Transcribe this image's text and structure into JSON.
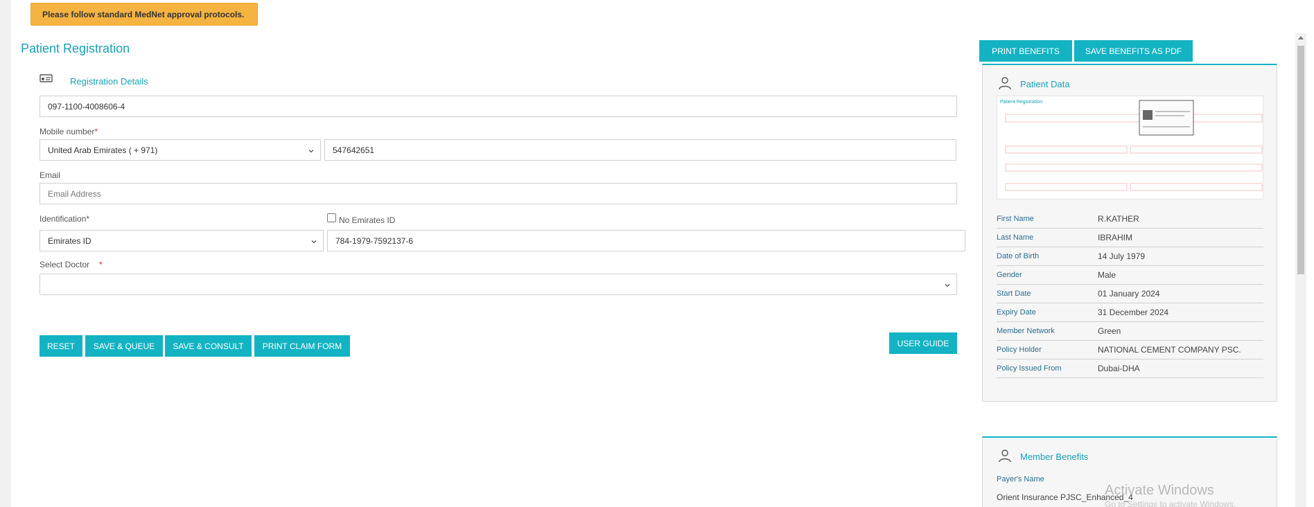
{
  "banner": {
    "text": "Please follow standard MedNet approval protocols."
  },
  "page_title": "Patient Registration",
  "registration": {
    "section_label": "Registration Details",
    "card_number": "097-1100-4008606-4",
    "mobile_label": "Mobile number",
    "required_mark": "*",
    "country_code": "United Arab Emirates ( + 971)",
    "mobile_value": "547642651",
    "email_label": "Email",
    "email_placeholder": "Email Address",
    "identification_label": "Identification*",
    "no_emirates_id_label": "No Emirates ID",
    "identification_type": "Emirates ID",
    "identification_value": "784-1979-7592137-6",
    "doctor_label": "Select Doctor",
    "doctor_value": ""
  },
  "actions": {
    "reset": "RESET",
    "save_queue": "SAVE & QUEUE",
    "save_consult": "SAVE & CONSULT",
    "print_claim": "PRINT CLAIM FORM",
    "user_guide": "USER GUIDE"
  },
  "benefits_actions": {
    "print_benefits": "PRINT BENEFITS",
    "save_pdf": "SAVE BENEFITS AS PDF"
  },
  "patient_data": {
    "title": "Patient Data",
    "rows": [
      {
        "key": "First Name",
        "value": "R.KATHER"
      },
      {
        "key": "Last Name",
        "value": "IBRAHIM"
      },
      {
        "key": "Date of Birth",
        "value": "14 July 1979"
      },
      {
        "key": "Gender",
        "value": "Male"
      },
      {
        "key": "Start Date",
        "value": "01 January 2024"
      },
      {
        "key": "Expiry Date",
        "value": "31 December 2024"
      },
      {
        "key": "Member Network",
        "value": "Green"
      },
      {
        "key": "Policy Holder",
        "value": "NATIONAL CEMENT COMPANY PSC."
      },
      {
        "key": "Policy Issued From",
        "value": "Dubai-DHA"
      }
    ]
  },
  "member_benefits": {
    "title": "Member Benefits",
    "payer_label": "Payer's Name",
    "payer_value": "Orient Insurance PJSC_Enhanced_4"
  },
  "watermark": {
    "line1": "Activate Windows",
    "line2": "Go to Settings to activate Windows."
  },
  "colors": {
    "accent": "#13b3c3",
    "banner": "#f5b342",
    "title": "#18a1b3",
    "required": "#d9302c"
  }
}
